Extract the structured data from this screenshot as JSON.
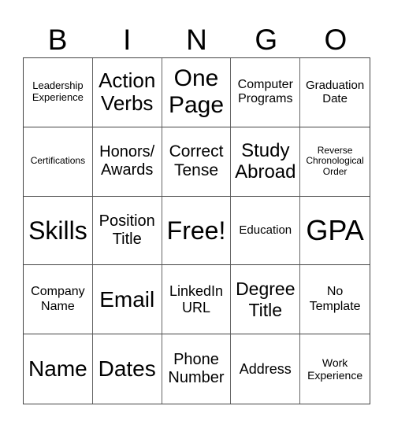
{
  "header": [
    "B",
    "I",
    "N",
    "G",
    "O"
  ],
  "cells": [
    "Leadership Experience",
    "Action Verbs",
    "One Page",
    "Computer Programs",
    "Graduation Date",
    "Certifications",
    "Honors/ Awards",
    "Correct Tense",
    "Study Abroad",
    "Reverse Chronological Order",
    "Skills",
    "Position Title",
    "Free!",
    "Education",
    "GPA",
    "Company Name",
    "Email",
    "LinkedIn URL",
    "Degree Title",
    "No Template",
    "Name",
    "Dates",
    "Phone Number",
    "Address",
    "Work Experience"
  ]
}
